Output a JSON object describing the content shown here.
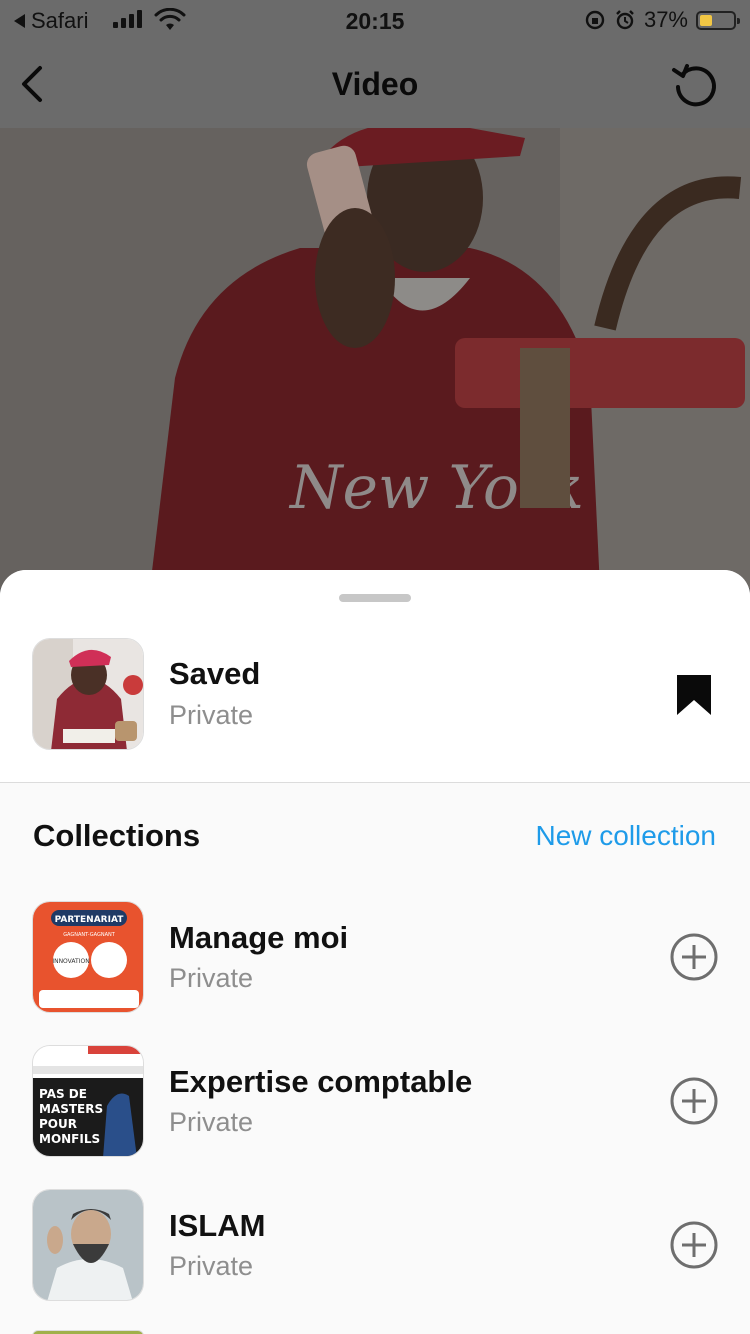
{
  "status_bar": {
    "back_app": "Safari",
    "time": "20:15",
    "battery_percent": "37%"
  },
  "nav": {
    "title": "Video"
  },
  "sheet": {
    "saved": {
      "title": "Saved",
      "privacy": "Private"
    },
    "collections_heading": "Collections",
    "new_collection_label": "New collection",
    "collections": [
      {
        "title": "Manage moi",
        "privacy": "Private",
        "thumb_text": [
          "PARTENARIAT",
          "GAGNANT-GAGNANT",
          "INNOVATION"
        ]
      },
      {
        "title": "Expertise comptable",
        "privacy": "Private",
        "thumb_text": [
          "PAS DE",
          "MASTERS",
          "POUR",
          "MONFILS"
        ]
      },
      {
        "title": "ISLAM",
        "privacy": "Private"
      }
    ]
  },
  "colors": {
    "accent": "#1e9be9",
    "battery_fill": "#f2c744"
  }
}
